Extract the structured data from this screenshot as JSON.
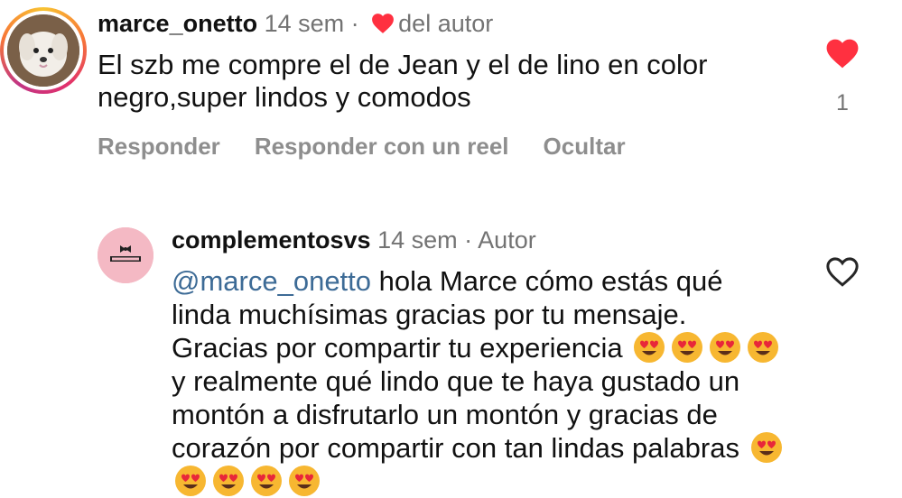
{
  "comment": {
    "username": "marce_onetto",
    "time": "14 sem",
    "separator": "·",
    "liked_by_author": "del autor",
    "text": "El szb me compre el de Jean y el de lino en color negro,super lindos y comodos",
    "like_count": "1",
    "actions": {
      "reply": "Responder",
      "reply_reel": "Responder con un reel",
      "hide": "Ocultar"
    }
  },
  "reply": {
    "username": "complementosvs",
    "time": "14 sem",
    "separator": "·",
    "role": "Autor",
    "mention": "@marce_onetto",
    "text_part1": " hola Marce cómo estás qué linda muchísimas gracias por tu mensaje. Gracias por compartir tu experiencia ",
    "text_part2": "y realmente qué lindo que te haya gustado un montón a disfrutarlo un montón y gracias de corazón por compartir con tan lindas palabras ",
    "emoji_name": "heart-eyes-emoji"
  },
  "colors": {
    "like_red": "#ff3040",
    "muted_text": "#737373",
    "action_text": "#8e8e8e",
    "mention_blue": "#3d6b96"
  }
}
